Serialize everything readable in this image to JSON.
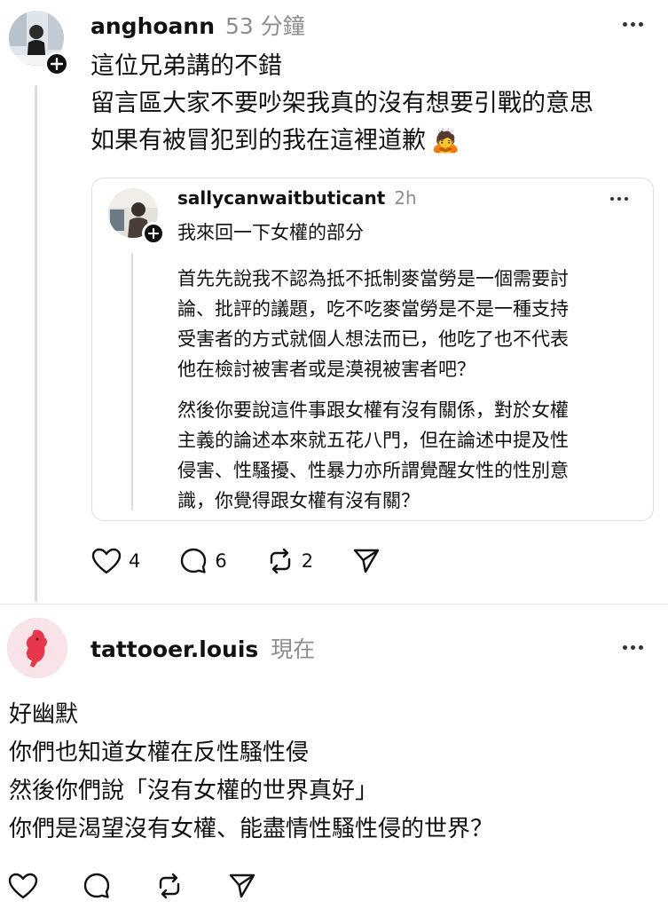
{
  "post1": {
    "username": "anghoann",
    "time": "53 分鐘",
    "lines": [
      "這位兄弟講的不錯",
      "留言區大家不要吵架我真的沒有想要引戰的意思",
      "如果有被冒犯到的我在這裡道歉"
    ],
    "emoji": "🙇"
  },
  "quoted": {
    "username": "sallycanwaitbuticant",
    "time": "2h",
    "headline": "我來回一下女權的部分",
    "paragraph1": "首先先說我不認為抵不抵制麥當勞是一個需要討\n論、批評的議題，吃不吃麥當勞是不是一種支持\n受害者的方式就個人想法而已，他吃了也不代表\n他在檢討被害者或是漠視被害者吧？",
    "paragraph2": "然後你要說這件事跟女權有沒有關係，對於女權\n主義的論述本來就五花八門，但在論述中提及性\n侵害、性騷擾、性暴力亦所謂覺醒女性的性別意\n識，你覺得跟女權有沒有關？"
  },
  "post1_actions": {
    "likes": "4",
    "comments": "6",
    "reposts": "2"
  },
  "post2": {
    "username": "tattooer.louis",
    "time": "現在",
    "lines": [
      "好幽默",
      "你們也知道女權在反性騷性侵",
      "然後你們說「沒有女權的世界真好」",
      "你們是渴望沒有女權、能盡情性騷性侵的世界？"
    ]
  },
  "icons": {
    "like": "heart-icon",
    "comment": "comment-bubble-icon",
    "repost": "repost-icon",
    "share": "send-icon",
    "more": "more-dots-icon",
    "follow": "plus-icon"
  }
}
